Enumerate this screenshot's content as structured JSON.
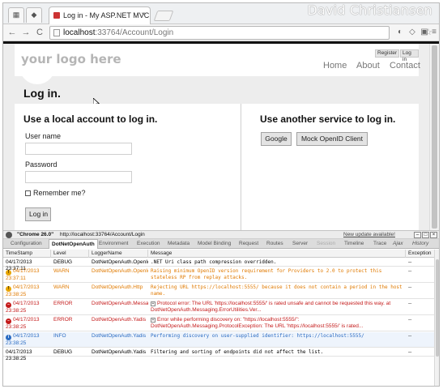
{
  "watermark": "David Christiansen",
  "browser": {
    "tab_title": "Log in - My ASP.NET MVC",
    "tab_close": "×",
    "url_host": "localhost",
    "url_path": ":33764/Account/Login",
    "nav_back": "←",
    "nav_forward": "→",
    "nav_reload": "C"
  },
  "site": {
    "logo": "your logo here",
    "register": "Register",
    "login": "Log in",
    "nav": [
      "Home",
      "About",
      "Contact"
    ],
    "page_title": "Log in."
  },
  "local_login": {
    "heading": "Use a local account to log in.",
    "username_label": "User name",
    "username_value": "",
    "password_label": "Password",
    "password_value": "",
    "remember_label": "Remember me?",
    "submit": "Log in"
  },
  "external_login": {
    "heading": "Use another service to log in.",
    "buttons": [
      "Google",
      "Mock OpenID Client"
    ]
  },
  "glimpse": {
    "client": "\"Chrome 26.0\"",
    "request_url": "http://localhost:33764/Account/Login",
    "update_link": "New update available!",
    "tabs": [
      "Configuration",
      "DotNetOpenAuth",
      "Environment",
      "Execution",
      "Metadata",
      "Model Binding",
      "Request",
      "Routes",
      "Server",
      "Session",
      "Timeline",
      "Trace",
      "Ajax",
      "History"
    ],
    "active_tab": "DotNetOpenAuth",
    "columns": [
      "TimeStamp",
      "Level",
      "LoggerName",
      "Message",
      "Exception"
    ],
    "rows": [
      {
        "time": "04/17/2013 23:37:11",
        "level": "DEBUG",
        "logger": "DotNetOpenAuth.OpenId",
        "message": ".NET Uri class path compression overridden.",
        "exception": "--"
      },
      {
        "time": "04/17/2013 23:37:11",
        "level": "WARN",
        "logger": "DotNetOpenAuth.OpenId",
        "message": "Raising minimum OpenID version requirement for Providers to 2.0 to protect this stateless RP from replay attacks.",
        "exception": "--"
      },
      {
        "time": "04/17/2013 23:38:25",
        "level": "WARN",
        "logger": "DotNetOpenAuth.Http",
        "message": "Rejecting URL https://localhost:5555/ because it does not contain a period in the host name.",
        "exception": "--"
      },
      {
        "time": "04/17/2013 23:38:25",
        "level": "ERROR",
        "logger": "DotNetOpenAuth.Messaging",
        "message": "Protocol error: The URL 'https://localhost:5555/' is rated unsafe and cannot be requested this way. at DotNetOpenAuth.Messaging.ErrorUtilities.Ver...",
        "exception": "--"
      },
      {
        "time": "04/17/2013 23:38:25",
        "level": "ERROR",
        "logger": "DotNetOpenAuth.Yadis",
        "message": "Error while performing discovery on: \"https://localhost:5555/\": DotNetOpenAuth.Messaging.ProtocolException: The URL 'https://localhost:5555/' is rated...",
        "exception": "--"
      },
      {
        "time": "04/17/2013 23:38:25",
        "level": "INFO",
        "logger": "DotNetOpenAuth.Yadis",
        "message": "Performing discovery on user-supplied identifier: https://localhost:5555/",
        "exception": "--"
      },
      {
        "time": "04/17/2013 23:38:25",
        "level": "DEBUG",
        "logger": "DotNetOpenAuth.Yadis",
        "message": "Filtering and sorting of endpoints did not affect the list.",
        "exception": "--"
      }
    ]
  },
  "colors": {
    "warn": "#e07a00",
    "error": "#c41a1a",
    "info": "#2a6bc2",
    "page_bg": "#ededed"
  }
}
